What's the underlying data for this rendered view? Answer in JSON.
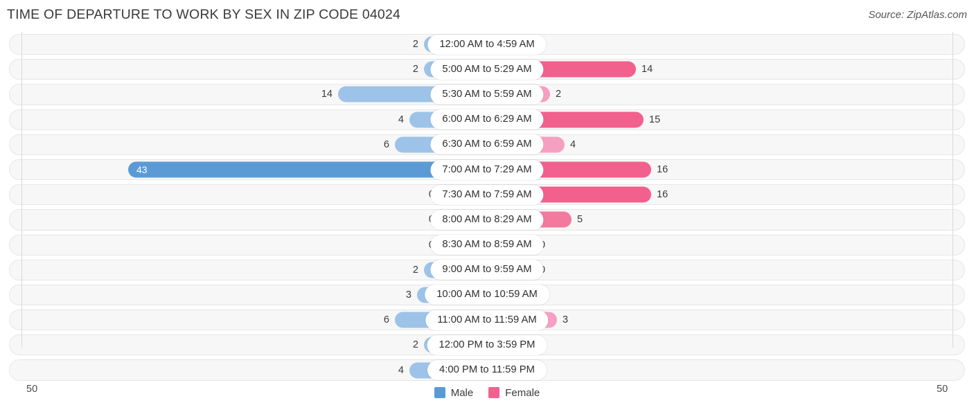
{
  "header": {
    "title": "TIME OF DEPARTURE TO WORK BY SEX IN ZIP CODE 04024",
    "source": "Source: ZipAtlas.com"
  },
  "axis": {
    "left_label": "50",
    "right_label": "50"
  },
  "legend": [
    {
      "label": "Male",
      "color": "#5B9BD5"
    },
    {
      "label": "Female",
      "color": "#F2608E"
    }
  ],
  "colors": {
    "male_light": "#9DC3E8",
    "male_dark": "#5B9BD5",
    "female_light": "#F79FC0",
    "female_mid": "#F4799F",
    "female_dark": "#F2608E",
    "track_bg": "#F7F7F7",
    "track_border": "#E6E6E6",
    "gridline": "#D8D8D8"
  },
  "chart_data": {
    "type": "bar",
    "orientation": "horizontal",
    "style": "diverging-bidirectional",
    "title": "TIME OF DEPARTURE TO WORK BY SEX IN ZIP CODE 04024",
    "xlabel": "",
    "ylabel": "",
    "xlim": [
      -50,
      50
    ],
    "axis_max": 50,
    "grid": true,
    "legend_position": "bottom-center",
    "categories": [
      "12:00 AM to 4:59 AM",
      "5:00 AM to 5:29 AM",
      "5:30 AM to 5:59 AM",
      "6:00 AM to 6:29 AM",
      "6:30 AM to 6:59 AM",
      "7:00 AM to 7:29 AM",
      "7:30 AM to 7:59 AM",
      "8:00 AM to 8:29 AM",
      "8:30 AM to 8:59 AM",
      "9:00 AM to 9:59 AM",
      "10:00 AM to 10:59 AM",
      "11:00 AM to 11:59 AM",
      "12:00 PM to 3:59 PM",
      "4:00 PM to 11:59 PM"
    ],
    "series": [
      {
        "name": "Male",
        "side": "left",
        "values": [
          2,
          2,
          14,
          4,
          6,
          43,
          0,
          0,
          0,
          2,
          3,
          6,
          2,
          4
        ]
      },
      {
        "name": "Female",
        "side": "right",
        "values": [
          0,
          14,
          2,
          15,
          4,
          16,
          16,
          5,
          0,
          0,
          0,
          3,
          0,
          0
        ]
      }
    ]
  },
  "rows": [
    {
      "category": "12:00 AM to 4:59 AM",
      "male": "2",
      "female": "0",
      "male_w": 91,
      "female_w": 68,
      "male_color": "#9DC3E8",
      "female_color": "#F79FC0",
      "male_inside": false
    },
    {
      "category": "5:00 AM to 5:29 AM",
      "male": "2",
      "female": "14",
      "male_w": 91,
      "female_w": 215,
      "male_color": "#9DC3E8",
      "female_color": "#F2608E",
      "male_inside": false
    },
    {
      "category": "5:30 AM to 5:59 AM",
      "male": "14",
      "female": "2",
      "male_w": 215,
      "female_w": 91,
      "male_color": "#9DC3E8",
      "female_color": "#F79FC0",
      "male_inside": false
    },
    {
      "category": "6:00 AM to 6:29 AM",
      "male": "4",
      "female": "15",
      "male_w": 112,
      "female_w": 226,
      "male_color": "#9DC3E8",
      "female_color": "#F2608E",
      "male_inside": false
    },
    {
      "category": "6:30 AM to 6:59 AM",
      "male": "6",
      "female": "4",
      "male_w": 133,
      "female_w": 112,
      "male_color": "#9DC3E8",
      "female_color": "#F79FC0",
      "male_inside": false
    },
    {
      "category": "7:00 AM to 7:29 AM",
      "male": "43",
      "female": "16",
      "male_w": 518,
      "female_w": 237,
      "male_color": "#5B9BD5",
      "female_color": "#F2608E",
      "male_inside": true
    },
    {
      "category": "7:30 AM to 7:59 AM",
      "male": "0",
      "female": "16",
      "male_w": 68,
      "female_w": 237,
      "male_color": "#9DC3E8",
      "female_color": "#F2608E",
      "male_inside": false
    },
    {
      "category": "8:00 AM to 8:29 AM",
      "male": "0",
      "female": "5",
      "male_w": 68,
      "female_w": 122,
      "male_color": "#9DC3E8",
      "female_color": "#F4799F",
      "male_inside": false
    },
    {
      "category": "8:30 AM to 8:59 AM",
      "male": "0",
      "female": "0",
      "male_w": 68,
      "female_w": 68,
      "male_color": "#9DC3E8",
      "female_color": "#F79FC0",
      "male_inside": false
    },
    {
      "category": "9:00 AM to 9:59 AM",
      "male": "2",
      "female": "0",
      "male_w": 91,
      "female_w": 68,
      "male_color": "#9DC3E8",
      "female_color": "#F79FC0",
      "male_inside": false
    },
    {
      "category": "10:00 AM to 10:59 AM",
      "male": "3",
      "female": "0",
      "male_w": 101,
      "female_w": 68,
      "male_color": "#9DC3E8",
      "female_color": "#F79FC0",
      "male_inside": false
    },
    {
      "category": "11:00 AM to 11:59 AM",
      "male": "6",
      "female": "3",
      "male_w": 133,
      "female_w": 101,
      "male_color": "#9DC3E8",
      "female_color": "#F79FC0",
      "male_inside": false
    },
    {
      "category": "12:00 PM to 3:59 PM",
      "male": "2",
      "female": "0",
      "male_w": 91,
      "female_w": 68,
      "male_color": "#9DC3E8",
      "female_color": "#F79FC0",
      "male_inside": false
    },
    {
      "category": "4:00 PM to 11:59 PM",
      "male": "4",
      "female": "0",
      "male_w": 112,
      "female_w": 68,
      "male_color": "#9DC3E8",
      "female_color": "#F79FC0",
      "male_inside": false
    }
  ]
}
